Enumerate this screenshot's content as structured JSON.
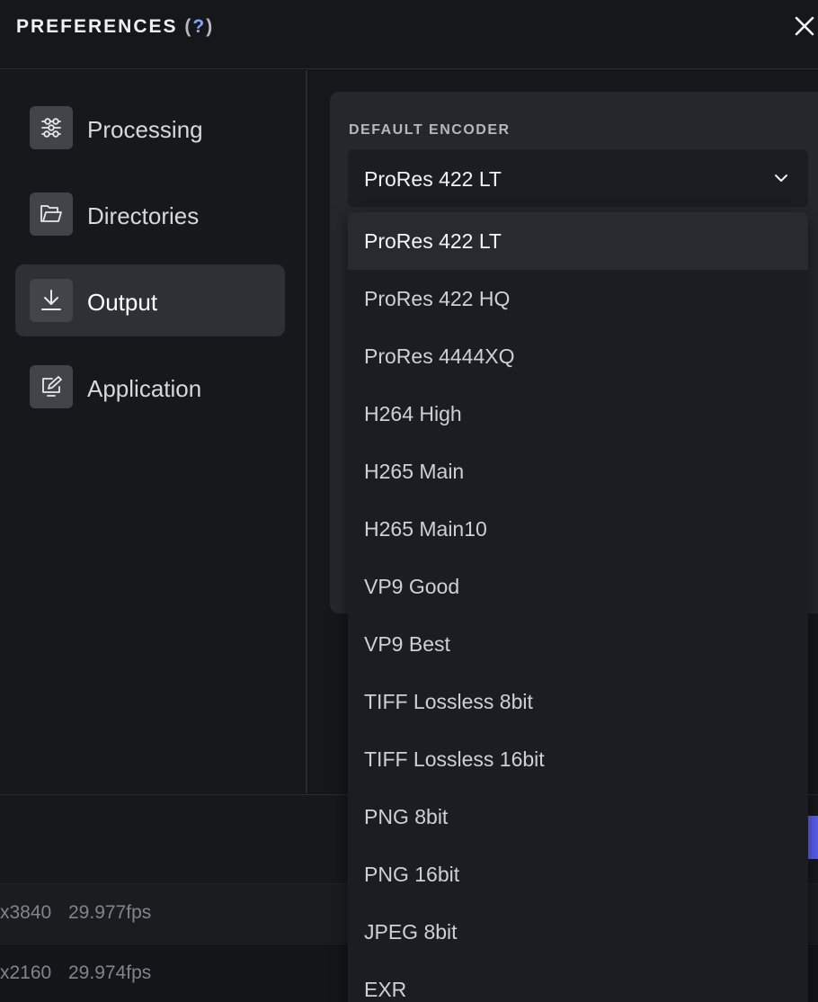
{
  "header": {
    "title": "PREFERENCES",
    "help_open": " (",
    "help_q": "?",
    "help_close": ")"
  },
  "sidebar": {
    "items": [
      {
        "label": "Processing",
        "icon": "sliders-icon",
        "active": false
      },
      {
        "label": "Directories",
        "icon": "folder-icon",
        "active": false
      },
      {
        "label": "Output",
        "icon": "download-icon",
        "active": true
      },
      {
        "label": "Application",
        "icon": "edit-monitor-icon",
        "active": false
      }
    ]
  },
  "main": {
    "encoder": {
      "label": "DEFAULT ENCODER",
      "value": "ProRes 422 LT",
      "options": [
        "ProRes 422 LT",
        "ProRes 422 HQ",
        "ProRes 4444XQ",
        "H264 High",
        "H265 Main",
        "H265 Main10",
        "VP9 Good",
        "VP9 Best",
        "TIFF Lossless 8bit",
        "TIFF Lossless 16bit",
        "PNG 8bit",
        "PNG 16bit",
        "JPEG 8bit",
        "EXR"
      ]
    }
  },
  "table": {
    "rows": [
      {
        "res": "x3840",
        "fps": "29.977fps"
      },
      {
        "res": "x2160",
        "fps": "29.974fps"
      }
    ]
  },
  "colors": {
    "accent": "#5a61f0",
    "help_link": "#7aa7ff",
    "background": "#141519"
  }
}
